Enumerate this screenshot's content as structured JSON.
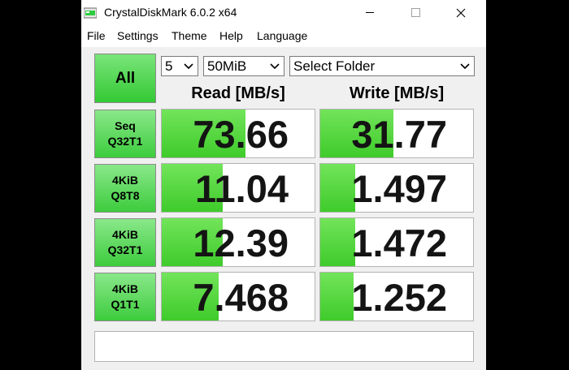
{
  "window": {
    "title": "CrystalDiskMark 6.0.2 x64",
    "controls": {
      "minimize": "—",
      "maximize": "☐",
      "close": "✕"
    }
  },
  "menu": [
    "File",
    "Settings",
    "Theme",
    "Help",
    "Language"
  ],
  "toolbar": {
    "all_label": "All",
    "count_value": "5",
    "size_value": "50MiB",
    "folder_value": "Select Folder",
    "arrow": "⌵"
  },
  "headers": {
    "read": "Read [MB/s]",
    "write": "Write [MB/s]"
  },
  "tests": [
    {
      "line1": "Seq",
      "line2": "Q32T1",
      "read": "73.66",
      "write": "31.77",
      "read_fill": 0.55,
      "write_fill": 0.48
    },
    {
      "line1": "4KiB",
      "line2": "Q8T8",
      "read": "11.04",
      "write": "1.497",
      "read_fill": 0.4,
      "write_fill": 0.23
    },
    {
      "line1": "4KiB",
      "line2": "Q32T1",
      "read": "12.39",
      "write": "1.472",
      "read_fill": 0.4,
      "write_fill": 0.23
    },
    {
      "line1": "4KiB",
      "line2": "Q1T1",
      "read": "7.468",
      "write": "1.252",
      "read_fill": 0.37,
      "write_fill": 0.22
    }
  ],
  "status_text": "",
  "colors": {
    "accent_green": "#3fcb2b",
    "window_bg": "#f0f0f0"
  }
}
